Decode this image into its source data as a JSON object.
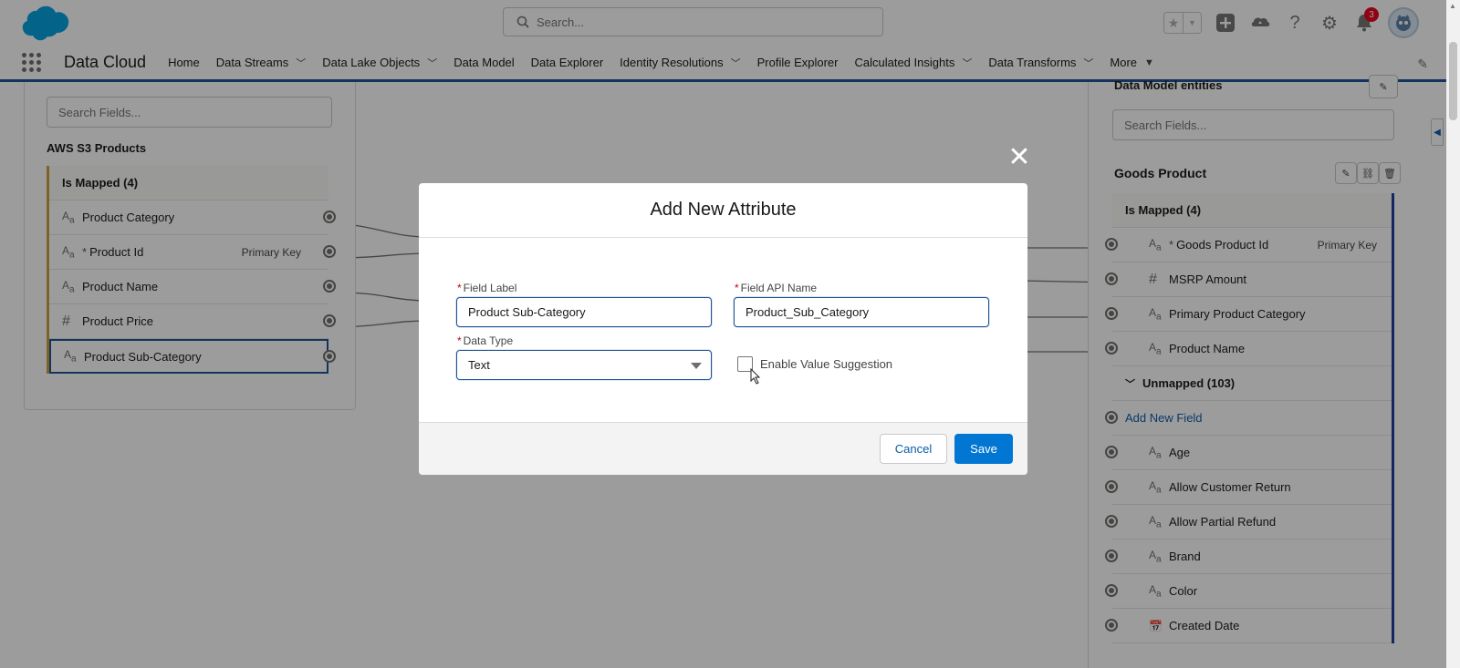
{
  "header": {
    "search_placeholder": "Search...",
    "notification_count": "3"
  },
  "nav": {
    "app_name": "Data Cloud",
    "items": [
      {
        "label": "Home",
        "dropdown": false
      },
      {
        "label": "Data Streams",
        "dropdown": true
      },
      {
        "label": "Data Lake Objects",
        "dropdown": true
      },
      {
        "label": "Data Model",
        "dropdown": false
      },
      {
        "label": "Data Explorer",
        "dropdown": false
      },
      {
        "label": "Identity Resolutions",
        "dropdown": true
      },
      {
        "label": "Profile Explorer",
        "dropdown": false
      },
      {
        "label": "Calculated Insights",
        "dropdown": true
      },
      {
        "label": "Data Transforms",
        "dropdown": true
      },
      {
        "label": "More",
        "dropdown": true
      }
    ]
  },
  "left_panel": {
    "search_placeholder": "Search Fields...",
    "source_name": "AWS S3 Products",
    "group_header": "Is Mapped (4)",
    "rows": [
      {
        "type": "text",
        "label": "Product Category",
        "required": false,
        "key": ""
      },
      {
        "type": "text",
        "label": "Product Id",
        "required": true,
        "key": "Primary Key"
      },
      {
        "type": "text",
        "label": "Product Name",
        "required": false,
        "key": ""
      },
      {
        "type": "number",
        "label": "Product Price",
        "required": false,
        "key": ""
      },
      {
        "type": "text",
        "label": "Product Sub-Category",
        "required": false,
        "key": ""
      }
    ]
  },
  "right_panel": {
    "title": "Data Model entities",
    "search_placeholder": "Search Fields...",
    "entity_name": "Goods Product",
    "mapped_header": "Is Mapped (4)",
    "mapped_rows": [
      {
        "type": "text",
        "label": "Goods Product Id",
        "required": true,
        "key": "Primary Key"
      },
      {
        "type": "number",
        "label": "MSRP Amount",
        "required": false,
        "key": ""
      },
      {
        "type": "text",
        "label": "Primary Product Category",
        "required": false,
        "key": ""
      },
      {
        "type": "text",
        "label": "Product Name",
        "required": false,
        "key": ""
      }
    ],
    "unmapped_header": "Unmapped (103)",
    "add_field_label": "Add New Field",
    "unmapped_rows": [
      {
        "type": "text",
        "label": "Age"
      },
      {
        "type": "text",
        "label": "Allow Customer Return"
      },
      {
        "type": "text",
        "label": "Allow Partial Refund"
      },
      {
        "type": "text",
        "label": "Brand"
      },
      {
        "type": "text",
        "label": "Color"
      },
      {
        "type": "date",
        "label": "Created Date"
      }
    ]
  },
  "modal": {
    "title": "Add New Attribute",
    "field_label_label": "Field Label",
    "field_label_value": "Product Sub-Category",
    "field_api_label": "Field API Name",
    "field_api_value": "Product_Sub_Category",
    "data_type_label": "Data Type",
    "data_type_value": "Text",
    "enable_suggestion_label": "Enable Value Suggestion",
    "enable_suggestion_checked": false,
    "cancel_label": "Cancel",
    "save_label": "Save"
  },
  "colors": {
    "brand_blue": "#0176d3",
    "nav_underline": "#1b5297",
    "mapped_accent": "#c8a03c",
    "overlay": "rgba(8,7,7,0.4)"
  }
}
